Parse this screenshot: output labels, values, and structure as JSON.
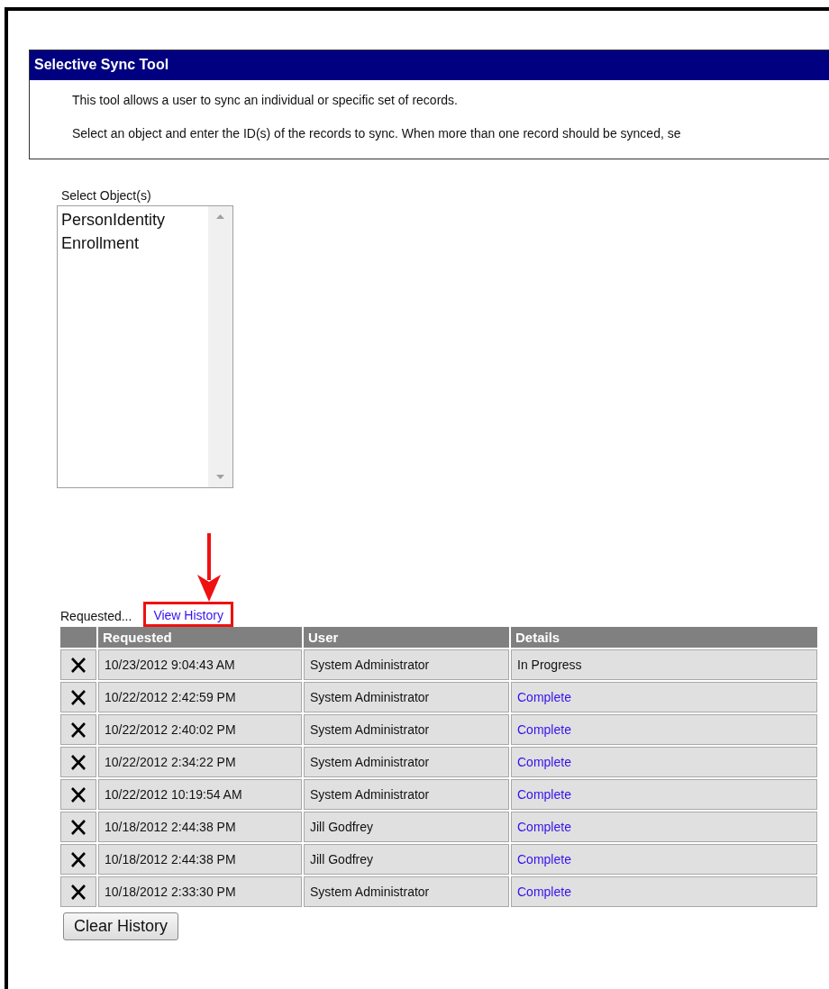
{
  "panel": {
    "title": "Selective Sync Tool",
    "paragraphs": [
      "This tool allows a user to sync an individual or specific set of records.",
      "Select an object and enter the ID(s) of the records to sync. When more than one record should be synced, se"
    ]
  },
  "object_list": {
    "label": "Select Object(s)",
    "items": [
      {
        "label": "PersonIdentity",
        "selected": false
      },
      {
        "label": "Enrollment",
        "selected": false
      }
    ]
  },
  "history": {
    "label": "Requested...",
    "link": "View History",
    "table": {
      "columns": [
        "Requested",
        "User",
        "Details"
      ],
      "rows": [
        {
          "requested": "10/23/2012 9:04:43 AM",
          "user": "System Administrator",
          "details": {
            "text": "In Progress",
            "kind": "text"
          }
        },
        {
          "requested": "10/22/2012 2:42:59 PM",
          "user": "System Administrator",
          "details": {
            "text": "Complete",
            "kind": "link"
          }
        },
        {
          "requested": "10/22/2012 2:40:02 PM",
          "user": "System Administrator",
          "details": {
            "text": "Complete",
            "kind": "link"
          }
        },
        {
          "requested": "10/22/2012 2:34:22 PM",
          "user": "System Administrator",
          "details": {
            "text": "Complete",
            "kind": "link"
          }
        },
        {
          "requested": "10/22/2012 10:19:54 AM",
          "user": "System Administrator",
          "details": {
            "text": "Complete",
            "kind": "link"
          }
        },
        {
          "requested": "10/18/2012 2:44:38 PM",
          "user": "Jill Godfrey",
          "details": {
            "text": "Complete",
            "kind": "link"
          }
        },
        {
          "requested": "10/18/2012 2:44:38 PM",
          "user": "Jill Godfrey",
          "details": {
            "text": "Complete",
            "kind": "link"
          }
        },
        {
          "requested": "10/18/2012 2:33:30 PM",
          "user": "System Administrator",
          "details": {
            "text": "Complete",
            "kind": "link"
          }
        }
      ]
    },
    "button": "Clear History"
  }
}
